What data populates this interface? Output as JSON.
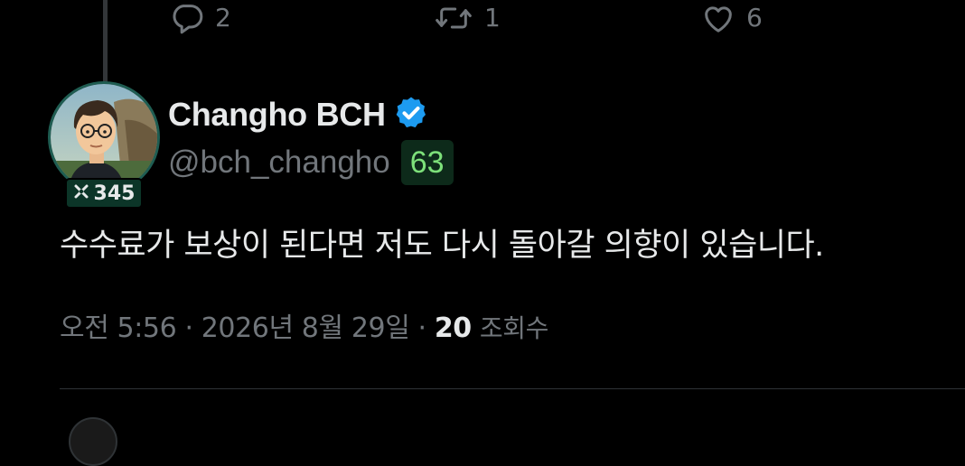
{
  "actions": {
    "reply_count": "2",
    "retweet_count": "1",
    "like_count": "6"
  },
  "author": {
    "display_name": "Changho BCH",
    "handle": "@bch_changho",
    "handle_badge": "63",
    "score_badge": "345",
    "verified": true
  },
  "tweet": {
    "text": "수수료가 보상이 된다면 저도 다시 돌아갈 의향이 있습니다."
  },
  "meta": {
    "timestamp": "오전 5:56 · 2026년 8월 29일 · ",
    "views_count": "20",
    "views_label": "조회수"
  },
  "colors": {
    "background": "#000000",
    "text_primary": "#e7e9ea",
    "text_secondary": "#71767b",
    "verified_blue": "#1d9bf0",
    "badge_green_text": "#7de07a"
  },
  "icons": {
    "reply": "reply-icon",
    "retweet": "retweet-icon",
    "like": "like-icon",
    "verified": "verified-badge-icon",
    "score": "x-score-icon"
  }
}
